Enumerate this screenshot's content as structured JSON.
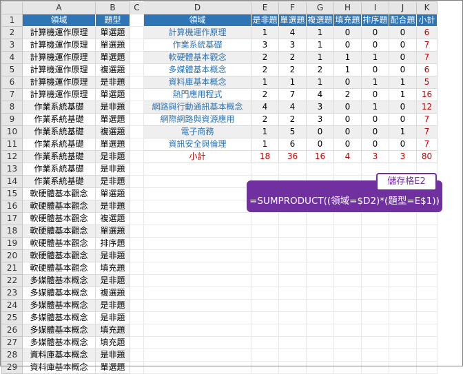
{
  "columns": [
    "A",
    "B",
    "C",
    "D",
    "E",
    "F",
    "G",
    "H",
    "I",
    "J",
    "K"
  ],
  "headers": {
    "A": "領域",
    "B": "題型",
    "D": "領域",
    "E": "是非題",
    "F": "單選題",
    "G": "複選題",
    "H": "填充題",
    "I": "排序題",
    "J": "配合題",
    "K": "小計"
  },
  "rows_AB": [
    [
      "計算機運作原理",
      "單選題"
    ],
    [
      "計算機運作原理",
      "單選題"
    ],
    [
      "計算機運作原理",
      "單選題"
    ],
    [
      "計算機運作原理",
      "複選題"
    ],
    [
      "計算機運作原理",
      "是非題"
    ],
    [
      "計算機運作原理",
      "單選題"
    ],
    [
      "作業系統基礎",
      "是非題"
    ],
    [
      "作業系統基礎",
      "單選題"
    ],
    [
      "作業系統基礎",
      "複選題"
    ],
    [
      "作業系統基礎",
      "單選題"
    ],
    [
      "作業系統基礎",
      "是非題"
    ],
    [
      "作業系統基礎",
      "是非題"
    ],
    [
      "作業系統基礎",
      "是非題"
    ],
    [
      "軟硬體基本觀念",
      "單選題"
    ],
    [
      "軟硬體基本觀念",
      "是非題"
    ],
    [
      "軟硬體基本觀念",
      "複選題"
    ],
    [
      "軟硬體基本觀念",
      "單選題"
    ],
    [
      "軟硬體基本觀念",
      "排序題"
    ],
    [
      "軟硬體基本觀念",
      "是非題"
    ],
    [
      "軟硬體基本觀念",
      "填充題"
    ],
    [
      "多媒體基本概念",
      "是非題"
    ],
    [
      "多媒體基本概念",
      "複選題"
    ],
    [
      "多媒體基本概念",
      "是非題"
    ],
    [
      "多媒體基本概念",
      "是非題"
    ],
    [
      "多媒體基本概念",
      "填充題"
    ],
    [
      "多媒體基本概念",
      "填充題"
    ],
    [
      "資料庫基本概念",
      "是非題"
    ],
    [
      "資料庫基本概念",
      "單選題"
    ]
  ],
  "summary": [
    {
      "domain": "計算機運作原理",
      "vals": [
        1,
        4,
        1,
        0,
        0,
        0,
        6
      ]
    },
    {
      "domain": "作業系統基礎",
      "vals": [
        3,
        3,
        1,
        0,
        0,
        0,
        7
      ]
    },
    {
      "domain": "軟硬體基本觀念",
      "vals": [
        2,
        2,
        1,
        1,
        1,
        0,
        7
      ]
    },
    {
      "domain": "多媒體基本概念",
      "vals": [
        2,
        2,
        2,
        1,
        0,
        0,
        6
      ]
    },
    {
      "domain": "資料庫基本概念",
      "vals": [
        1,
        1,
        1,
        0,
        1,
        1,
        5
      ]
    },
    {
      "domain": "熱門應用程式",
      "vals": [
        2,
        7,
        4,
        2,
        0,
        1,
        16
      ]
    },
    {
      "domain": "網路與行動通訊基本概念",
      "vals": [
        4,
        4,
        3,
        0,
        1,
        0,
        12
      ]
    },
    {
      "domain": "網際網路與資源應用",
      "vals": [
        2,
        2,
        3,
        0,
        0,
        0,
        7
      ]
    },
    {
      "domain": "電子商務",
      "vals": [
        1,
        5,
        0,
        0,
        0,
        1,
        7
      ]
    },
    {
      "domain": "資訊安全與倫理",
      "vals": [
        1,
        6,
        0,
        0,
        0,
        0,
        7
      ]
    }
  ],
  "totals": {
    "label": "小計",
    "vals": [
      18,
      36,
      16,
      4,
      3,
      3,
      80
    ]
  },
  "callout": {
    "label": "儲存格E2",
    "formula": "=SUMPRODUCT((領域=$D2)*(題型=E$1))"
  },
  "colors": {
    "header_blue": "#2f75b5",
    "domain_text": "#2e74b5",
    "total_red": "#c00000",
    "callout_purple": "#7030a0"
  }
}
